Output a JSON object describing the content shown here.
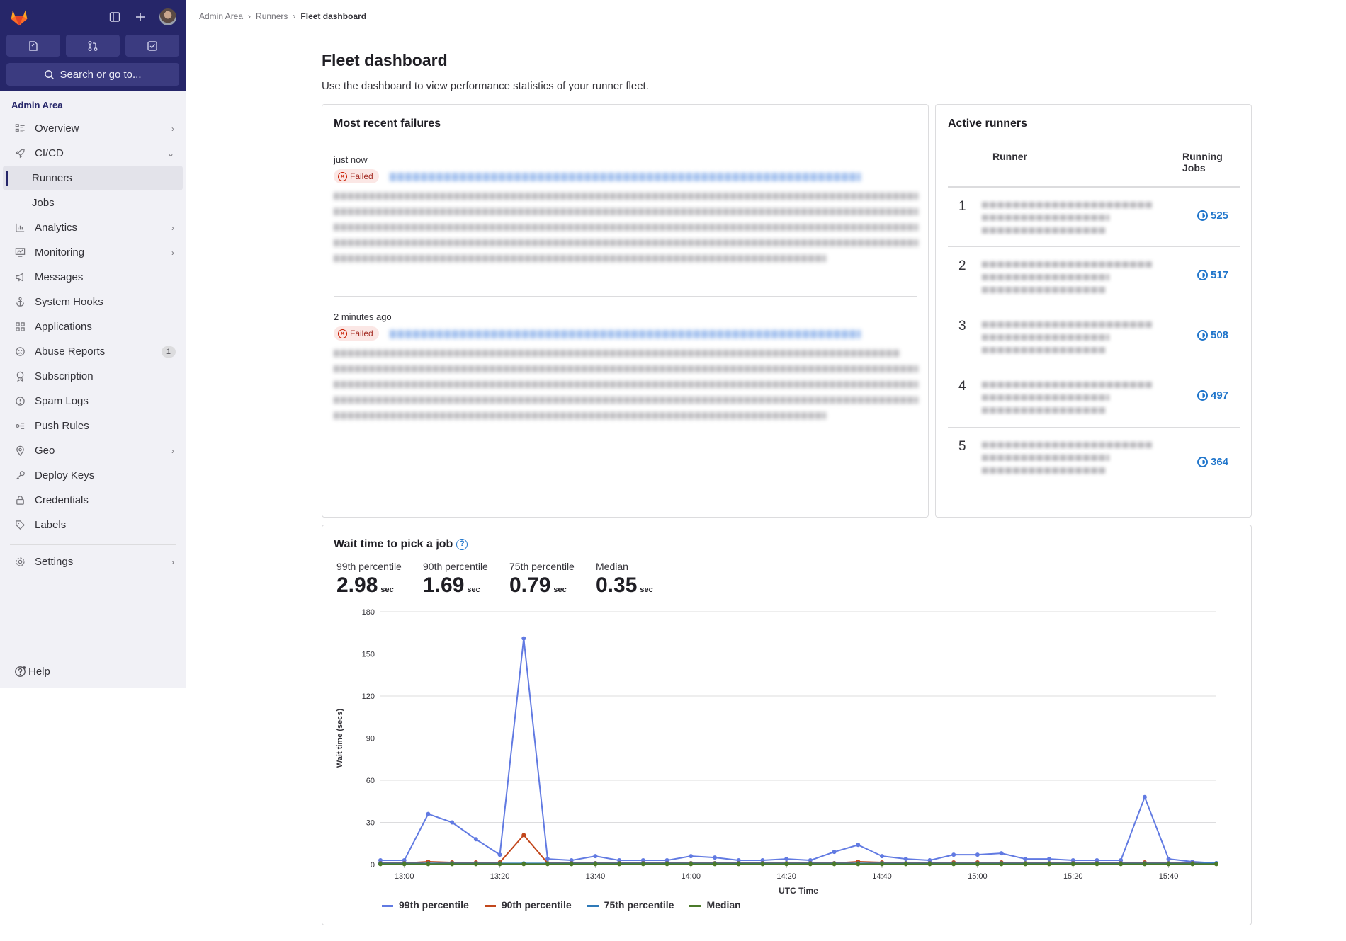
{
  "breadcrumb": [
    "Admin Area",
    "Runners",
    "Fleet dashboard"
  ],
  "sidebar": {
    "search_label": "Search or go to...",
    "section_label": "Admin Area",
    "items": [
      {
        "label": "Overview",
        "icon": "overview-icon"
      },
      {
        "label": "CI/CD",
        "icon": "rocket-icon"
      },
      {
        "label": "Runners"
      },
      {
        "label": "Jobs"
      },
      {
        "label": "Analytics",
        "icon": "chart-icon"
      },
      {
        "label": "Monitoring",
        "icon": "monitor-icon"
      },
      {
        "label": "Messages",
        "icon": "bullhorn-icon"
      },
      {
        "label": "System Hooks",
        "icon": "anchor-icon"
      },
      {
        "label": "Applications",
        "icon": "apps-icon"
      },
      {
        "label": "Abuse Reports",
        "icon": "abuse-icon",
        "badge": "1"
      },
      {
        "label": "Subscription",
        "icon": "medal-icon"
      },
      {
        "label": "Spam Logs",
        "icon": "spam-icon"
      },
      {
        "label": "Push Rules",
        "icon": "push-rules-icon"
      },
      {
        "label": "Geo",
        "icon": "location-icon"
      },
      {
        "label": "Deploy Keys",
        "icon": "key-icon"
      },
      {
        "label": "Credentials",
        "icon": "lock-icon"
      },
      {
        "label": "Labels",
        "icon": "label-icon"
      },
      {
        "label": "Settings",
        "icon": "gear-icon"
      }
    ],
    "help_label": "Help"
  },
  "page": {
    "title": "Fleet dashboard",
    "description": "Use the dashboard to view performance statistics of your runner fleet."
  },
  "failures": {
    "title": "Most recent failures",
    "items": [
      {
        "time": "just now",
        "status": "Failed"
      },
      {
        "time": "2 minutes ago",
        "status": "Failed"
      }
    ]
  },
  "active_runners": {
    "title": "Active runners",
    "col_runner": "Runner",
    "col_jobs": "Running Jobs",
    "rows": [
      {
        "rank": "1",
        "jobs": "525"
      },
      {
        "rank": "2",
        "jobs": "517"
      },
      {
        "rank": "3",
        "jobs": "508"
      },
      {
        "rank": "4",
        "jobs": "497"
      },
      {
        "rank": "5",
        "jobs": "364"
      }
    ]
  },
  "wait_time": {
    "title": "Wait time to pick a job",
    "stats": [
      {
        "label": "99th percentile",
        "value": "2.98",
        "unit": "sec"
      },
      {
        "label": "90th percentile",
        "value": "1.69",
        "unit": "sec"
      },
      {
        "label": "75th percentile",
        "value": "0.79",
        "unit": "sec"
      },
      {
        "label": "Median",
        "value": "0.35",
        "unit": "sec"
      }
    ]
  },
  "chart_data": {
    "type": "line",
    "xlabel": "UTC Time",
    "ylabel": "Wait time (secs)",
    "ylim": [
      0,
      180
    ],
    "yticks": [
      0,
      30,
      60,
      90,
      120,
      150,
      180
    ],
    "xticks": [
      "13:00",
      "13:20",
      "13:40",
      "14:00",
      "14:20",
      "14:40",
      "15:00",
      "15:20",
      "15:40"
    ],
    "x": [
      "12:55",
      "13:00",
      "13:05",
      "13:10",
      "13:15",
      "13:20",
      "13:25",
      "13:30",
      "13:35",
      "13:40",
      "13:45",
      "13:50",
      "13:55",
      "14:00",
      "14:05",
      "14:10",
      "14:15",
      "14:20",
      "14:25",
      "14:30",
      "14:35",
      "14:40",
      "14:45",
      "14:50",
      "14:55",
      "15:00",
      "15:05",
      "15:10",
      "15:15",
      "15:20",
      "15:25",
      "15:30",
      "15:35",
      "15:40",
      "15:45",
      "15:50"
    ],
    "grid": true,
    "legend_position": "bottom-left",
    "series": [
      {
        "name": "99th percentile",
        "color": "#617ae2",
        "values": [
          3,
          3,
          36,
          30,
          18,
          7,
          161,
          4,
          3,
          6,
          3,
          3,
          3,
          6,
          5,
          3,
          3,
          4,
          3,
          9,
          14,
          6,
          4,
          3,
          7,
          7,
          8,
          4,
          4,
          3,
          3,
          3,
          48,
          4,
          2,
          1
        ]
      },
      {
        "name": "90th percentile",
        "color": "#c2471c",
        "values": [
          1,
          1,
          2,
          1.5,
          1.5,
          1.5,
          21,
          1,
          1,
          1,
          1,
          1,
          1,
          1,
          1,
          1,
          1,
          1,
          1,
          1,
          2,
          1.5,
          1,
          1,
          1.5,
          1.5,
          1.5,
          1,
          1,
          1,
          1,
          1,
          1.5,
          1,
          1,
          0.5
        ]
      },
      {
        "name": "75th percentile",
        "color": "#2f7ab8",
        "values": [
          0.8,
          0.8,
          0.8,
          0.8,
          0.8,
          0.8,
          0.8,
          0.8,
          0.8,
          0.8,
          0.8,
          0.8,
          0.8,
          0.8,
          0.8,
          0.8,
          0.8,
          0.8,
          0.8,
          0.8,
          0.8,
          0.8,
          0.8,
          0.8,
          0.8,
          0.8,
          0.8,
          0.8,
          0.8,
          0.8,
          0.8,
          0.8,
          0.8,
          0.8,
          0.8,
          0.8
        ]
      },
      {
        "name": "Median",
        "color": "#4b7a2a",
        "values": [
          0.3,
          0.3,
          0.3,
          0.3,
          0.3,
          0.3,
          0.3,
          0.3,
          0.3,
          0.3,
          0.3,
          0.3,
          0.3,
          0.3,
          0.3,
          0.3,
          0.3,
          0.3,
          0.3,
          0.3,
          0.3,
          0.3,
          0.3,
          0.3,
          0.3,
          0.3,
          0.3,
          0.3,
          0.3,
          0.3,
          0.3,
          0.3,
          0.3,
          0.3,
          0.3,
          0.3
        ]
      }
    ]
  }
}
